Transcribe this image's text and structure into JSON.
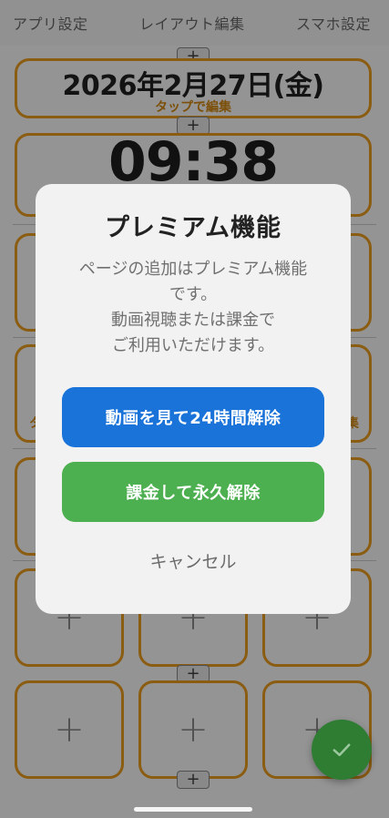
{
  "topbar": {
    "tab_app_settings": "アプリ設定",
    "tab_layout_edit": "レイアウト編集",
    "tab_phone_settings": "スマホ設定"
  },
  "widgets": {
    "date": "2026年2月27日(金)",
    "date_hint": "タップで編集",
    "time": "09:38",
    "add_symbol": "+",
    "partial_left": "タ",
    "partial_right": "集"
  },
  "modal": {
    "title": "プレミアム機能",
    "body_line1": "ページの追加はプレミアム機能",
    "body_line2": "です。",
    "body_line3": "動画視聴または課金で",
    "body_line4": "ご利用いただけます。",
    "video_button": "動画を見て24時間解除",
    "purchase_button": "課金して永久解除",
    "cancel_button": "キャンセル"
  },
  "colors": {
    "accent_orange": "#f0a020",
    "video_blue": "#1a73d9",
    "purchase_green": "#4caf50",
    "fab_green": "#2e7d32"
  },
  "icons": {
    "fab": "check-icon"
  }
}
